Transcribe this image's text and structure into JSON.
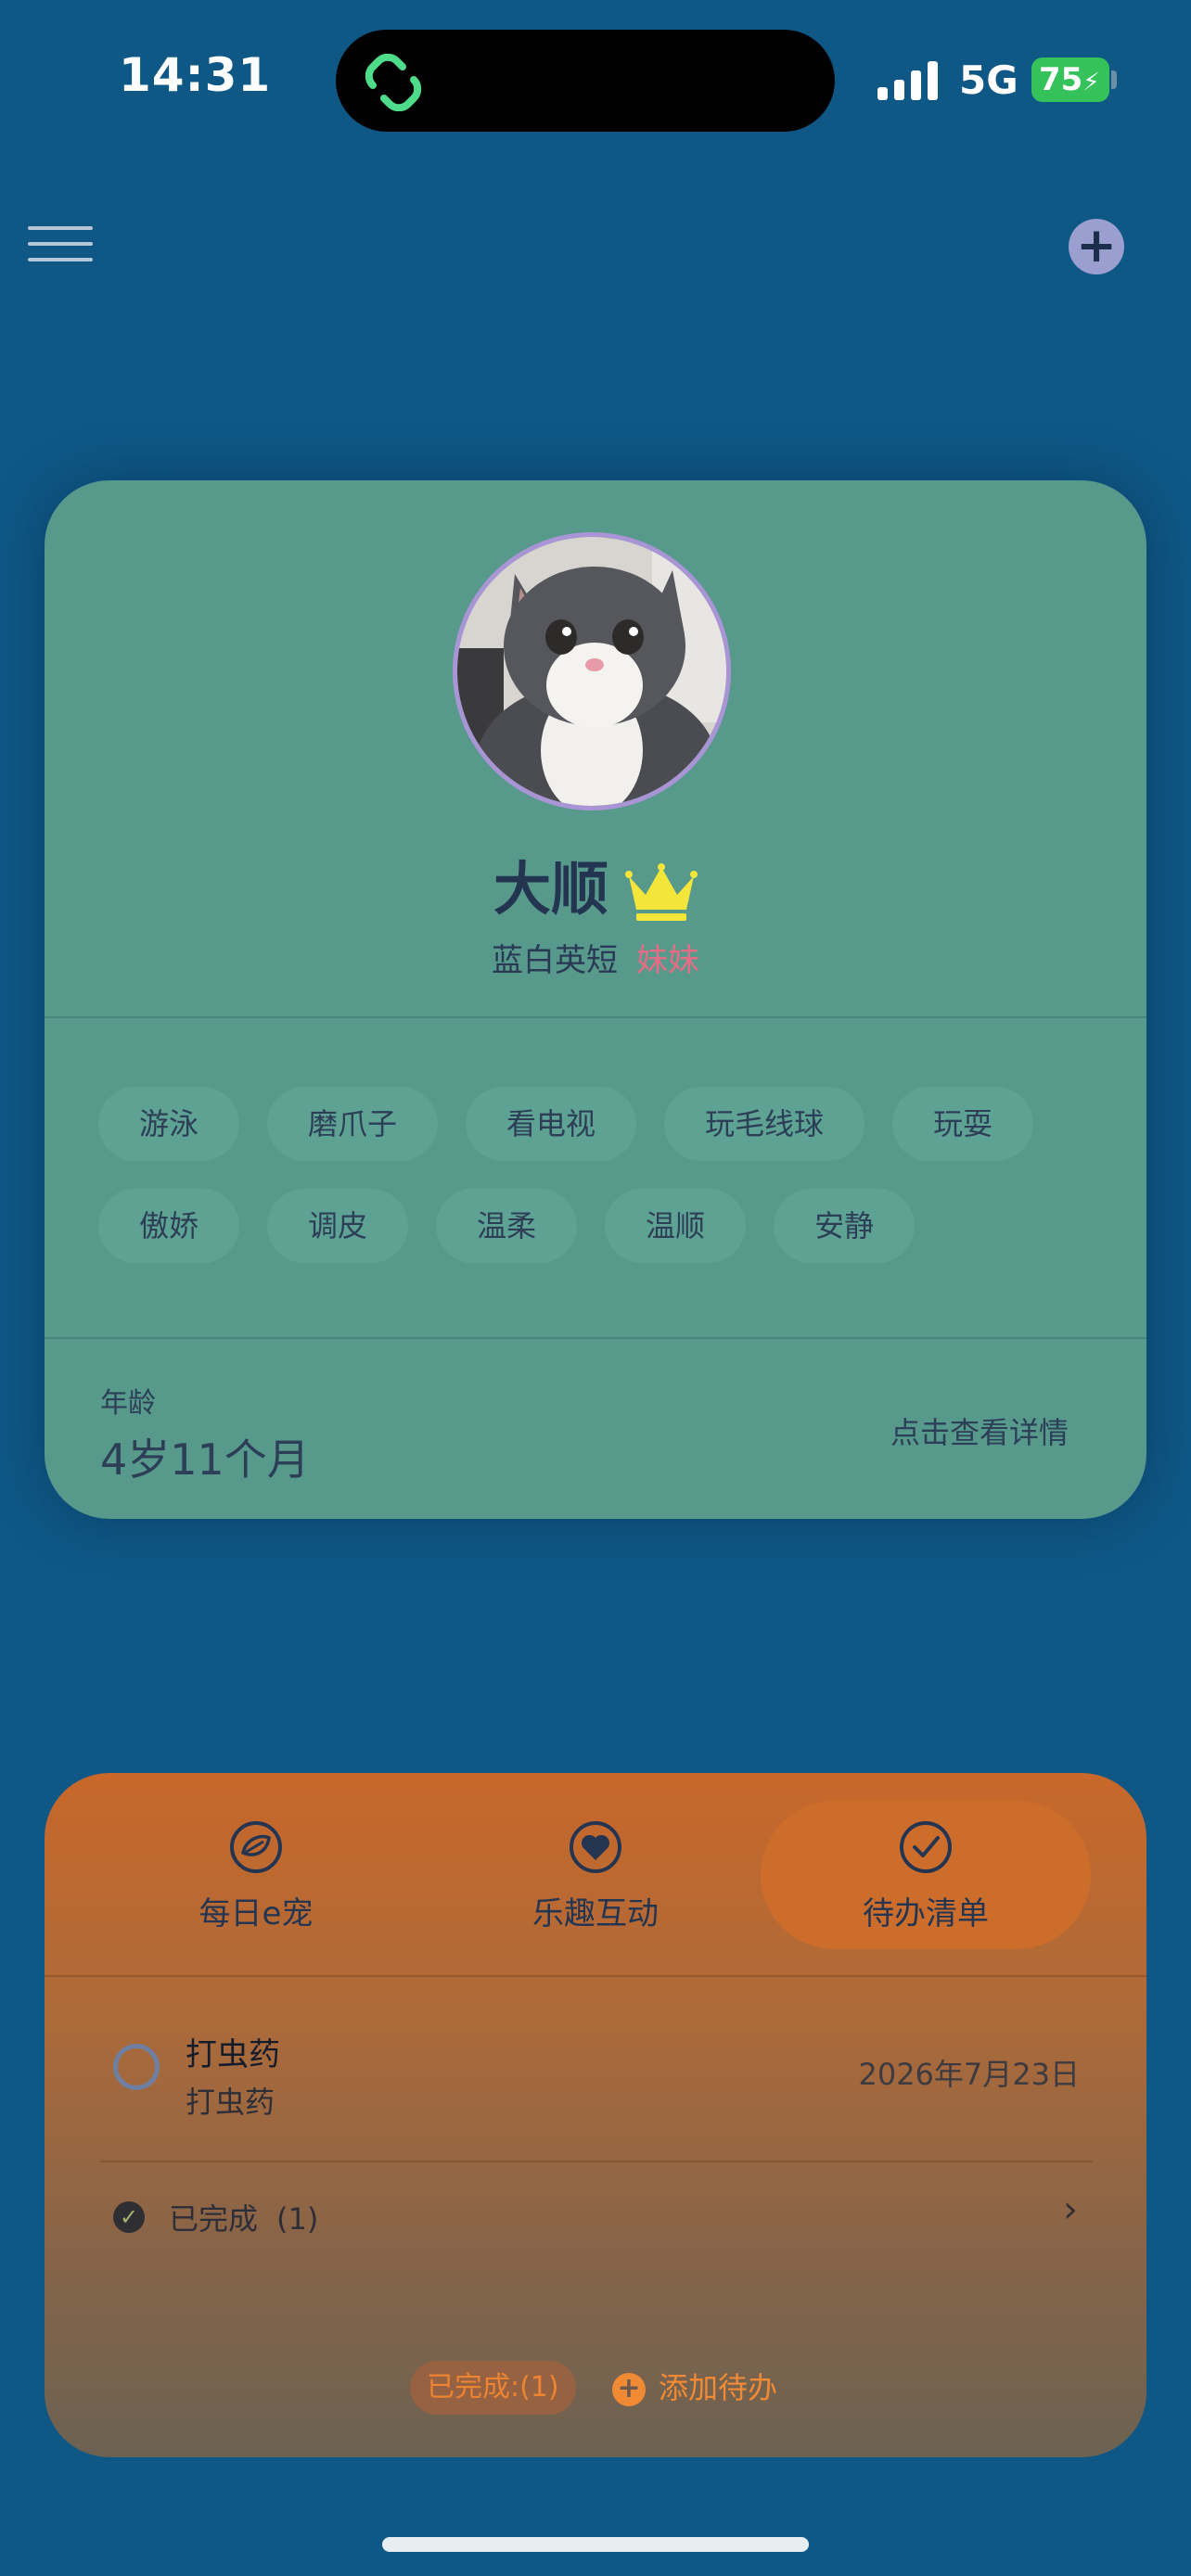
{
  "status_bar": {
    "time": "14:31",
    "network": "5G",
    "battery": "75",
    "icons": [
      "app-link-icon",
      "signal-bars-icon",
      "battery-charging-icon"
    ]
  },
  "header": {
    "menu_icon": "hamburger-menu-icon",
    "add_icon": "plus-icon",
    "add_symbol": "+"
  },
  "pet": {
    "name": "大顺",
    "breed": "蓝白英短",
    "gender": "妹妹",
    "badge_icon": "crown-icon",
    "tags_row1": [
      "游泳",
      "磨爪子",
      "看电视",
      "玩毛线球",
      "玩耍"
    ],
    "tags_row2": [
      "傲娇",
      "调皮",
      "温柔",
      "温顺",
      "安静"
    ],
    "age_label": "年龄",
    "age_value": "4岁11个月",
    "detail_link": "点击查看详情"
  },
  "todo_panel": {
    "tabs": [
      {
        "label": "每日e宠",
        "icon": "leaf-icon"
      },
      {
        "label": "乐趣互动",
        "icon": "heart-icon"
      },
      {
        "label": "待办清单",
        "icon": "checkmark-circle-icon",
        "active": true
      }
    ],
    "items": [
      {
        "title": "打虫药",
        "subtitle": "打虫药",
        "date": "2026年7月23日"
      }
    ],
    "completed_label": "已完成",
    "completed_count": "(1)",
    "footer_completed": "已完成:(1)",
    "add_todo_label": "添加待办",
    "add_symbol": "+",
    "check_symbol": "✓",
    "chevron": "›"
  },
  "colors": {
    "background": "#0f5886",
    "pet_card": "#579a8b",
    "accent_orange": "#f08a35",
    "gender_pink": "#e86b86",
    "crown_yellow": "#f4e53a"
  }
}
